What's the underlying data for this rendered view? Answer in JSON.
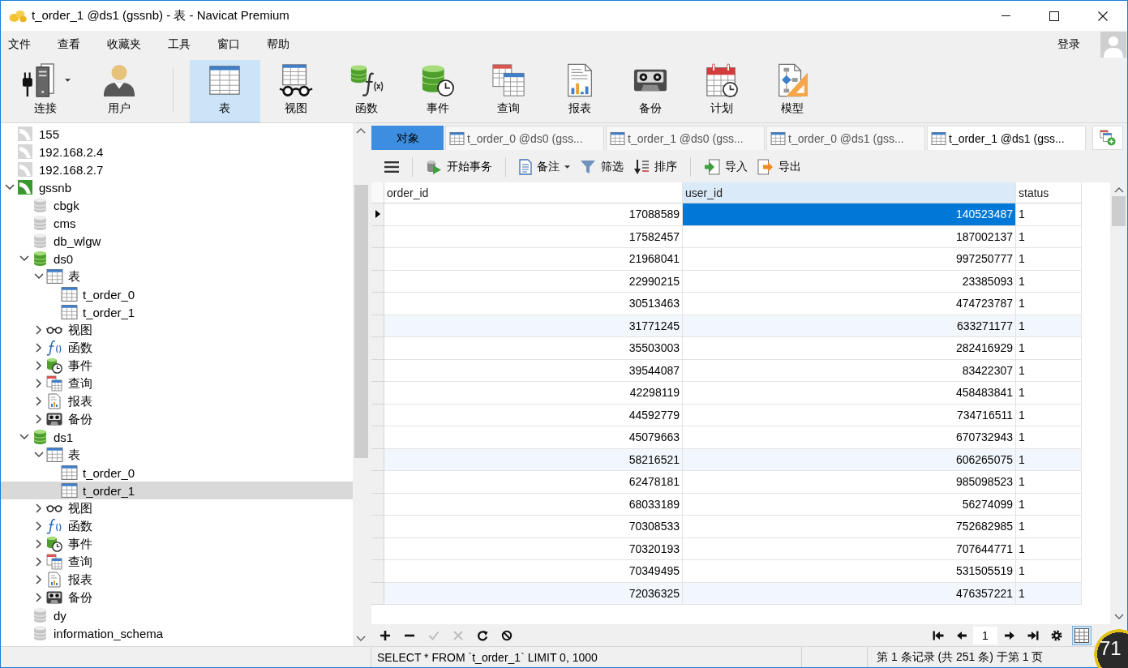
{
  "window": {
    "title": "t_order_1 @ds1 (gssnb) - 表 - Navicat Premium"
  },
  "menu": [
    "文件",
    "查看",
    "收藏夹",
    "工具",
    "窗口",
    "帮助"
  ],
  "account": {
    "label": "登录"
  },
  "toolbar": {
    "groups": [
      [
        {
          "label": "连接",
          "kind": "connection",
          "selected": false,
          "menu": true
        },
        {
          "label": "用户",
          "kind": "user",
          "selected": false
        }
      ],
      [
        {
          "label": "表",
          "kind": "table",
          "selected": true
        },
        {
          "label": "视图",
          "kind": "views",
          "selected": false
        },
        {
          "label": "函数",
          "kind": "functions",
          "selected": false
        },
        {
          "label": "事件",
          "kind": "events",
          "selected": false
        },
        {
          "label": "查询",
          "kind": "queries",
          "selected": false
        },
        {
          "label": "报表",
          "kind": "reports",
          "selected": false
        },
        {
          "label": "备份",
          "kind": "backups",
          "selected": false
        },
        {
          "label": "计划",
          "kind": "schedule",
          "selected": false
        },
        {
          "label": "模型",
          "kind": "model",
          "selected": false
        }
      ]
    ]
  },
  "navigator": {
    "tree": [
      {
        "label": "155",
        "kind": "connection",
        "open": false,
        "selected": false
      },
      {
        "label": "192.168.2.4",
        "kind": "connection",
        "open": false,
        "selected": false
      },
      {
        "label": "192.168.2.7",
        "kind": "connection",
        "open": false,
        "selected": false
      },
      {
        "label": "gssnb",
        "kind": "connection",
        "open": true,
        "expanded": true,
        "selected": false,
        "children": [
          {
            "label": "cbgk",
            "kind": "database",
            "open": false,
            "selected": false
          },
          {
            "label": "cms",
            "kind": "database",
            "open": false,
            "selected": false
          },
          {
            "label": "db_wlgw",
            "kind": "database",
            "open": false,
            "selected": false
          },
          {
            "label": "ds0",
            "kind": "database",
            "open": true,
            "expanded": true,
            "selected": false,
            "children": [
              {
                "label": "表",
                "kind": "tables",
                "expanded": true,
                "selected": false,
                "children": [
                  {
                    "label": "t_order_0",
                    "kind": "table",
                    "selected": false
                  },
                  {
                    "label": "t_order_1",
                    "kind": "table",
                    "selected": false
                  }
                ]
              },
              {
                "label": "视图",
                "kind": "views",
                "expanded": false,
                "selected": false
              },
              {
                "label": "函数",
                "kind": "functions",
                "expanded": false,
                "selected": false
              },
              {
                "label": "事件",
                "kind": "events",
                "expanded": false,
                "selected": false
              },
              {
                "label": "查询",
                "kind": "queries",
                "expanded": false,
                "selected": false
              },
              {
                "label": "报表",
                "kind": "reports",
                "expanded": false,
                "selected": false
              },
              {
                "label": "备份",
                "kind": "backups",
                "expanded": false,
                "selected": false
              }
            ]
          },
          {
            "label": "ds1",
            "kind": "database",
            "open": true,
            "expanded": true,
            "selected": false,
            "children": [
              {
                "label": "表",
                "kind": "tables",
                "expanded": true,
                "selected": false,
                "children": [
                  {
                    "label": "t_order_0",
                    "kind": "table",
                    "selected": false
                  },
                  {
                    "label": "t_order_1",
                    "kind": "table",
                    "selected": true
                  }
                ]
              },
              {
                "label": "视图",
                "kind": "views",
                "expanded": false,
                "selected": false
              },
              {
                "label": "函数",
                "kind": "functions",
                "expanded": false,
                "selected": false
              },
              {
                "label": "事件",
                "kind": "events",
                "expanded": false,
                "selected": false
              },
              {
                "label": "查询",
                "kind": "queries",
                "expanded": false,
                "selected": false
              },
              {
                "label": "报表",
                "kind": "reports",
                "expanded": false,
                "selected": false
              },
              {
                "label": "备份",
                "kind": "backups",
                "expanded": false,
                "selected": false
              }
            ]
          },
          {
            "label": "dy",
            "kind": "database",
            "open": false,
            "selected": false
          },
          {
            "label": "information_schema",
            "kind": "database",
            "open": false,
            "selected": false
          }
        ]
      }
    ]
  },
  "tabs": [
    {
      "label": "对象",
      "kind": "objects",
      "selected": false
    },
    {
      "label": "t_order_0 @ds0 (gss...",
      "kind": "table",
      "selected": false
    },
    {
      "label": "t_order_1 @ds0 (gss...",
      "kind": "table",
      "selected": false
    },
    {
      "label": "t_order_0 @ds1 (gss...",
      "kind": "table",
      "selected": false
    },
    {
      "label": "t_order_1 @ds1 (gss...",
      "kind": "table",
      "selected": true
    }
  ],
  "object_toolbar": [
    [
      {
        "kind": "menu"
      }
    ],
    [
      {
        "label": "开始事务",
        "kind": "transaction"
      }
    ],
    [
      {
        "label": "备注",
        "kind": "memo",
        "menu": true
      },
      {
        "label": "筛选",
        "kind": "filter"
      },
      {
        "label": "排序",
        "kind": "sort"
      }
    ],
    [
      {
        "label": "导入",
        "kind": "import"
      },
      {
        "label": "导出",
        "kind": "export"
      }
    ]
  ],
  "grid": {
    "columns": [
      {
        "label": "order_id",
        "kind": "number",
        "selected": false
      },
      {
        "label": "user_id",
        "kind": "number",
        "selected": true
      },
      {
        "label": "status",
        "kind": "text",
        "selected": false
      }
    ],
    "rows": [
      {
        "cells": [
          "17088589",
          "140523487",
          "1"
        ],
        "current": true
      },
      {
        "cells": [
          "17582457",
          "187002137",
          "1"
        ],
        "current": false
      },
      {
        "cells": [
          "21968041",
          "997250777",
          "1"
        ],
        "current": false
      },
      {
        "cells": [
          "22990215",
          "23385093",
          "1"
        ],
        "current": false
      },
      {
        "cells": [
          "30513463",
          "474723787",
          "1"
        ],
        "current": false
      },
      {
        "cells": [
          "31771245",
          "633271177",
          "1"
        ],
        "current": false
      },
      {
        "cells": [
          "35503003",
          "282416929",
          "1"
        ],
        "current": false
      },
      {
        "cells": [
          "39544087",
          "83422307",
          "1"
        ],
        "current": false
      },
      {
        "cells": [
          "42298119",
          "458483841",
          "1"
        ],
        "current": false
      },
      {
        "cells": [
          "44592779",
          "734716511",
          "1"
        ],
        "current": false
      },
      {
        "cells": [
          "45079663",
          "670732943",
          "1"
        ],
        "current": false
      },
      {
        "cells": [
          "58216521",
          "606265075",
          "1"
        ],
        "current": false
      },
      {
        "cells": [
          "62478181",
          "985098523",
          "1"
        ],
        "current": false
      },
      {
        "cells": [
          "68033189",
          "56274099",
          "1"
        ],
        "current": false
      },
      {
        "cells": [
          "70308533",
          "752682985",
          "1"
        ],
        "current": false
      },
      {
        "cells": [
          "70320193",
          "707644771",
          "1"
        ],
        "current": false
      },
      {
        "cells": [
          "70349495",
          "531505519",
          "1"
        ],
        "current": false
      },
      {
        "cells": [
          "72036325",
          "476357221",
          "1"
        ],
        "current": false
      }
    ]
  },
  "grid_actions": [
    {
      "kind": "add",
      "disabled": false
    },
    {
      "kind": "delete",
      "disabled": false
    },
    {
      "kind": "apply",
      "disabled": true
    },
    {
      "kind": "cancel",
      "disabled": true
    },
    {
      "kind": "refresh",
      "disabled": false
    },
    {
      "kind": "stop",
      "disabled": false
    }
  ],
  "pager": [
    {
      "kind": "first"
    },
    {
      "kind": "previous"
    },
    {
      "kind": "page",
      "value": "1"
    },
    {
      "kind": "next"
    },
    {
      "kind": "last"
    },
    {
      "kind": "settings"
    }
  ],
  "views": [
    {
      "kind": "grid",
      "selected": true
    }
  ],
  "status_bar": {
    "query": "SELECT * FROM `t_order_1` LIMIT 0, 1000",
    "records": "第 1 条记录 (共 251 条) 于第 1 页"
  },
  "speed_widget": {
    "text": "71"
  }
}
